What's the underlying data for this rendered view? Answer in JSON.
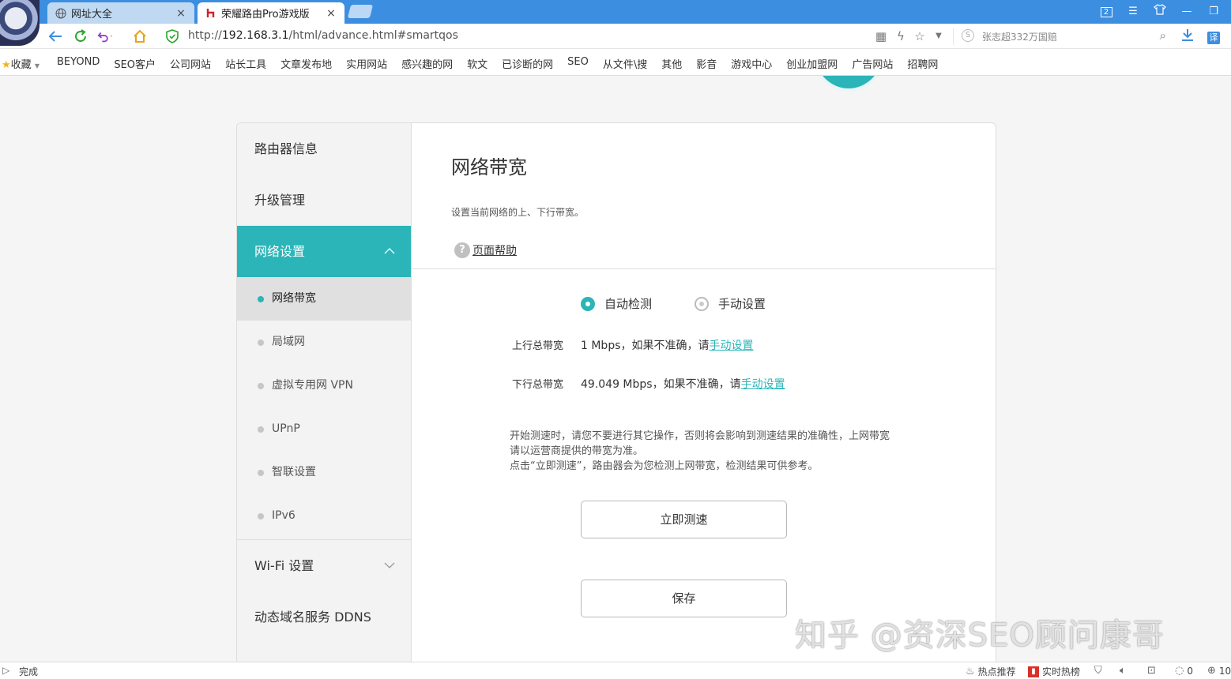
{
  "browser": {
    "tabs": [
      {
        "label": "网址大全",
        "icon": "globe-icon",
        "active": false
      },
      {
        "label": "荣耀路由Pro游戏版",
        "icon": "honor-logo-icon",
        "active": true
      }
    ],
    "window_badge": "2",
    "url_prefix": "http://",
    "url_host": "192.168.3.1",
    "url_path": "/html/advance.html#smartqos",
    "search_placeholder": "张志超332万国赔",
    "bookmarks_label": "收藏",
    "bookmarks": [
      "BEYOND",
      "SEO客户",
      "公司网站",
      "站长工具",
      "文章发布地",
      "实用网站",
      "感兴趣的网",
      "软文",
      "已诊断的网",
      "SEO",
      "从文件\\搜",
      "其他",
      "影音",
      "游戏中心",
      "创业加盟网",
      "广告网站",
      "招聘网"
    ]
  },
  "sidebar": {
    "items": [
      {
        "label": "路由器信息"
      },
      {
        "label": "升级管理"
      },
      {
        "label": "网络设置",
        "expanded": true
      }
    ],
    "sub_items": [
      {
        "label": "网络带宽",
        "active": true
      },
      {
        "label": "局域网"
      },
      {
        "label": "虚拟专用网 VPN"
      },
      {
        "label": "UPnP"
      },
      {
        "label": "智联设置"
      },
      {
        "label": "IPv6"
      }
    ],
    "bottom_items": [
      {
        "label": "Wi-Fi 设置",
        "expanded": false
      },
      {
        "label": "动态域名服务 DDNS"
      }
    ]
  },
  "content": {
    "title": "网络带宽",
    "description": "设置当前网络的上、下行带宽。",
    "help_label": "页面帮助",
    "radio_auto": "自动检测",
    "radio_manual": "手动设置",
    "selected_mode": "自动检测",
    "upload_label": "上行总带宽",
    "upload_value": "1 Mbps，如果不准确，请",
    "download_label": "下行总带宽",
    "download_value": "49.049 Mbps，如果不准确，请",
    "manual_link": "手动设置",
    "note_line1": "开始测速时，请您不要进行其它操作，否则将会影响到测速结果的准确性，上网带宽请以运营商提供的带宽为准。",
    "note_line2": "点击“立即测速”，路由器会为您检测上网带宽，检测结果可供参考。",
    "test_button": "立即测速",
    "save_button": "保存"
  },
  "watermark": "知乎 @资深SEO顾问康哥",
  "statusbar": {
    "status": "完成",
    "hot_recommend": "热点推荐",
    "realtime_hot": "实时热榜",
    "download_count": "0",
    "zoom": "10"
  },
  "colors": {
    "accent": "#2bb5b8",
    "tabbar": "#3c8ee0"
  }
}
